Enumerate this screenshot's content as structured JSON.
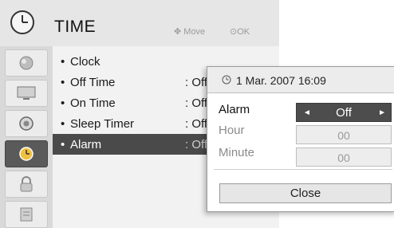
{
  "header": {
    "title": "TIME",
    "move_hint": "Move",
    "ok_hint": "OK"
  },
  "sidebar": {
    "tabs": [
      "picture",
      "screen",
      "audio",
      "time",
      "lock",
      "option"
    ],
    "active_index": 3
  },
  "menu": {
    "items": [
      {
        "label": "Clock",
        "value": ""
      },
      {
        "label": "Off Time",
        "value": ": Off"
      },
      {
        "label": "On Time",
        "value": ": Off"
      },
      {
        "label": "Sleep Timer",
        "value": ": Off"
      },
      {
        "label": "Alarm",
        "value": ": Off"
      }
    ],
    "active_index": 4
  },
  "popup": {
    "datetime": "1 Mar. 2007 16:09",
    "alarm_label": "Alarm",
    "alarm_value": "Off",
    "hour_label": "Hour",
    "hour_value": "00",
    "minute_label": "Minute",
    "minute_value": "00",
    "close_label": "Close"
  }
}
